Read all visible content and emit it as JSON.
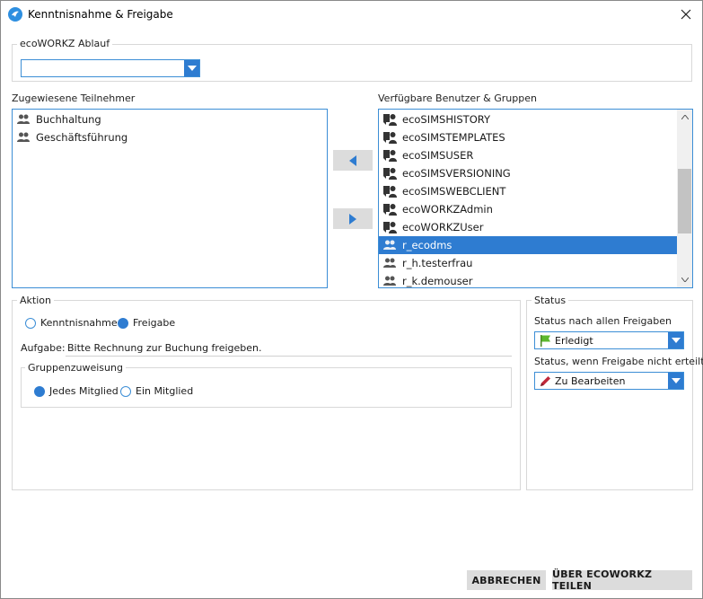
{
  "window": {
    "title": "Kenntnisnahme & Freigabe"
  },
  "ablauf": {
    "group_label": "ecoWORKZ Ablauf",
    "value": ""
  },
  "assigned": {
    "label": "Zugewiesene Teilnehmer",
    "items": [
      {
        "label": "Buchhaltung",
        "icon": "group-icon"
      },
      {
        "label": "Geschäftsführung",
        "icon": "group-icon"
      }
    ]
  },
  "available": {
    "label": "Verfügbare Benutzer & Gruppen",
    "items": [
      {
        "label": "ecoSIMSHISTORY",
        "icon": "role-icon",
        "selected": false
      },
      {
        "label": "ecoSIMSTEMPLATES",
        "icon": "role-icon",
        "selected": false
      },
      {
        "label": "ecoSIMSUSER",
        "icon": "role-icon",
        "selected": false
      },
      {
        "label": "ecoSIMSVERSIONING",
        "icon": "role-icon",
        "selected": false
      },
      {
        "label": "ecoSIMSWEBCLIENT",
        "icon": "role-icon",
        "selected": false
      },
      {
        "label": "ecoWORKZAdmin",
        "icon": "role-icon",
        "selected": false
      },
      {
        "label": "ecoWORKZUser",
        "icon": "role-icon",
        "selected": false
      },
      {
        "label": "r_ecodms",
        "icon": "group-icon",
        "selected": true
      },
      {
        "label": "r_h.testerfrau",
        "icon": "group-icon",
        "selected": false
      },
      {
        "label": "r_k.demouser",
        "icon": "group-icon",
        "selected": false
      }
    ]
  },
  "aktion": {
    "group_label": "Aktion",
    "options": [
      {
        "label": "Kenntnisnahme",
        "checked": false
      },
      {
        "label": "Freigabe",
        "checked": true
      }
    ],
    "task_label": "Aufgabe:",
    "task_value": "Bitte Rechnung zur Buchung freigeben.",
    "gruppen": {
      "group_label": "Gruppenzuweisung",
      "options": [
        {
          "label": "Jedes Mitglied",
          "checked": true
        },
        {
          "label": "Ein Mitglied",
          "checked": false
        }
      ]
    }
  },
  "status": {
    "group_label": "Status",
    "after_all_label": "Status nach allen Freigaben",
    "after_all_value": "Erledigt",
    "after_all_icon": "green-flag-icon",
    "not_granted_label": "Status, wenn Freigabe nicht erteilt",
    "not_granted_value": "Zu Bearbeiten",
    "not_granted_icon": "pencil-icon"
  },
  "buttons": {
    "cancel": "ABBRECHEN",
    "share": "ÜBER ECOWORKZ TEILEN"
  },
  "colors": {
    "accent": "#2e7cd1",
    "selection": "#2e7cd1",
    "button_bg": "#dcdcdc",
    "flag_green": "#5cb82e",
    "pencil_red": "#c0283a"
  }
}
